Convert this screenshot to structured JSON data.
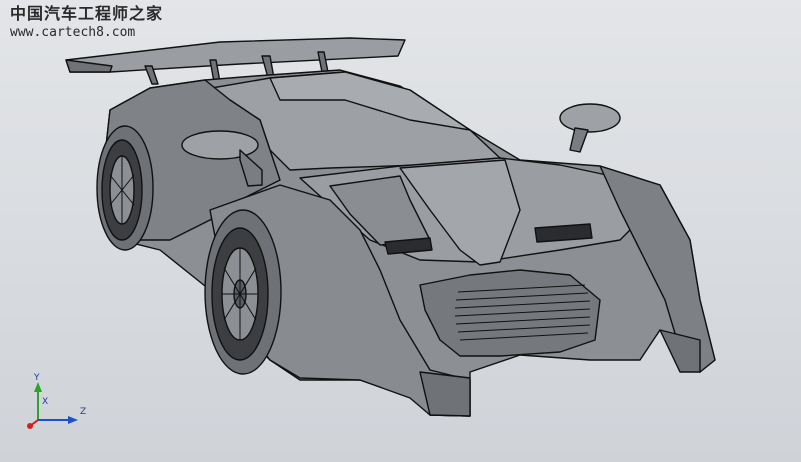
{
  "watermark": {
    "title": "中国汽车工程师之家",
    "url": "www.cartech8.com"
  },
  "triad": {
    "y_label": "Y",
    "x_label": "X",
    "z_label": "Z"
  },
  "colors": {
    "background": "#d6d9dd",
    "body_fill": "#8c8f94",
    "body_shade": "#6f7277",
    "edge": "#111111",
    "y_axis": "#2aa52a",
    "x_axis": "#d02020",
    "z_axis": "#2050c8"
  }
}
